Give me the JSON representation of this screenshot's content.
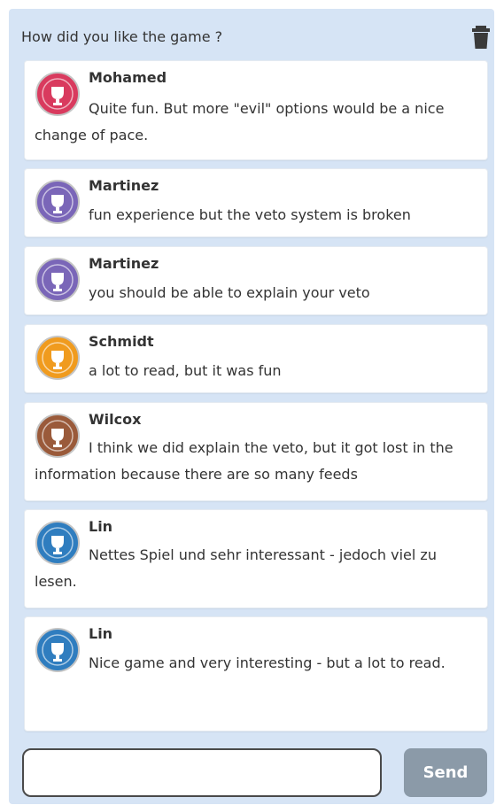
{
  "header": {
    "title": "How did you like the game ?"
  },
  "icons": {
    "trash": "trash-icon",
    "avatar": "trophy-badge-icon"
  },
  "colors": {
    "panel_bg": "#d6e4f5",
    "send_button": "#8b9aa8",
    "avatar_red": "#d93a5e",
    "avatar_purple": "#7a66b8",
    "avatar_orange": "#f09b1e",
    "avatar_brown": "#9a5a3a",
    "avatar_blue": "#2f7dbf"
  },
  "messages": [
    {
      "author": "Mohamed",
      "text": "Quite fun. But more \"evil\" options would be a nice change of pace.",
      "avatar_color": "#d93a5e"
    },
    {
      "author": "Martinez",
      "text": "fun experience but the veto system is broken",
      "avatar_color": "#7a66b8"
    },
    {
      "author": "Martinez",
      "text": "you should be able to explain your veto",
      "avatar_color": "#7a66b8"
    },
    {
      "author": "Schmidt",
      "text": "a lot to read, but it was fun",
      "avatar_color": "#f09b1e"
    },
    {
      "author": "Wilcox",
      "text": "I think we did explain the veto, but it got lost in the information because there are so many feeds",
      "avatar_color": "#9a5a3a"
    },
    {
      "author": "Lin",
      "text": "Nettes Spiel und sehr interessant - jedoch viel zu lesen.",
      "avatar_color": "#2f7dbf"
    },
    {
      "author": "Lin",
      "text": "Nice game and very interesting - but a lot to read.",
      "avatar_color": "#2f7dbf"
    }
  ],
  "composer": {
    "input_value": "",
    "input_placeholder": "",
    "send_label": "Send"
  }
}
